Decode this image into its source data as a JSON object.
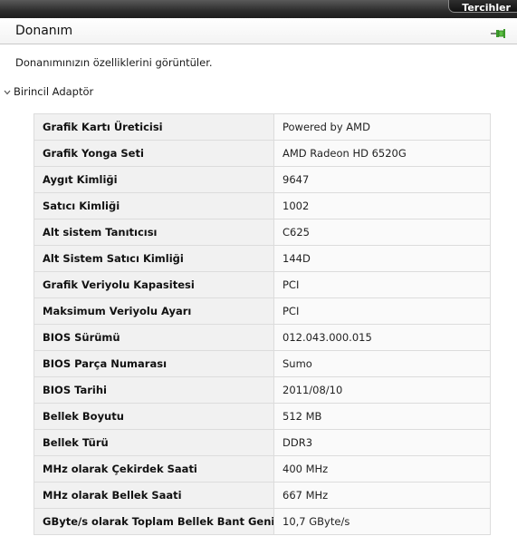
{
  "topbar": {
    "button_label": "Tercihler"
  },
  "header": {
    "title": "Donanım",
    "icon": "pin-icon"
  },
  "description": "Donanımınızın özelliklerini görüntüler.",
  "section": {
    "label": "Birincil Adaptör",
    "icon": "chevron-down-icon"
  },
  "properties": [
    {
      "label": "Grafik Kartı Üreticisi",
      "value": "Powered by AMD"
    },
    {
      "label": "Grafik Yonga Seti",
      "value": "AMD Radeon HD 6520G"
    },
    {
      "label": "Aygıt Kimliği",
      "value": "9647"
    },
    {
      "label": "Satıcı Kimliği",
      "value": "1002"
    },
    {
      "label": "Alt sistem Tanıtıcısı",
      "value": "C625"
    },
    {
      "label": "Alt Sistem Satıcı Kimliği",
      "value": "144D"
    },
    {
      "label": "Grafik Veriyolu Kapasitesi",
      "value": "PCI"
    },
    {
      "label": "Maksimum Veriyolu Ayarı",
      "value": "PCI"
    },
    {
      "label": "BIOS Sürümü",
      "value": "012.043.000.015"
    },
    {
      "label": "BIOS Parça Numarası",
      "value": "Sumo"
    },
    {
      "label": "BIOS Tarihi",
      "value": "2011/08/10"
    },
    {
      "label": "Bellek Boyutu",
      "value": "512 MB"
    },
    {
      "label": "Bellek Türü",
      "value": "DDR3"
    },
    {
      "label": "MHz olarak Çekirdek Saati",
      "value": "400 MHz"
    },
    {
      "label": "MHz olarak Bellek Saati",
      "value": "667 MHz"
    },
    {
      "label": "GByte/s olarak Toplam Bellek Bant Genişliği",
      "value": "10,7 GByte/s"
    }
  ]
}
